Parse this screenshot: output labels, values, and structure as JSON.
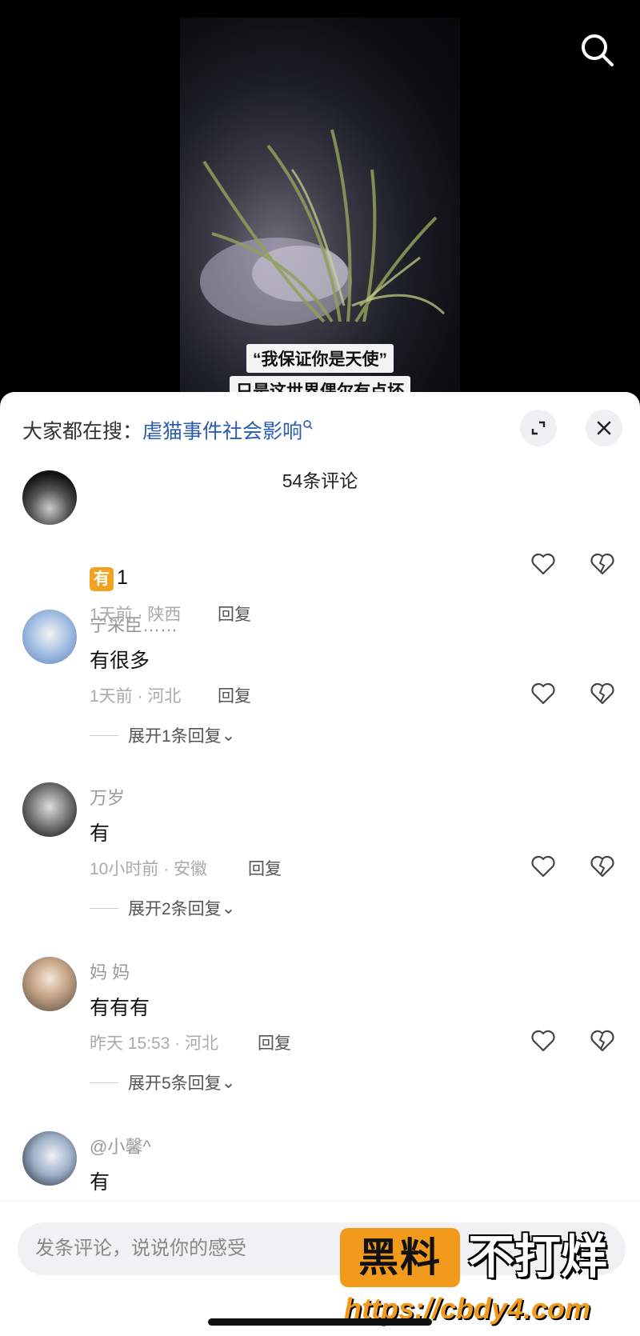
{
  "video": {
    "subtitle_line1": "“我保证你是天使”",
    "subtitle_line2": "只是这世界偶尔有点坏"
  },
  "sheet": {
    "search_prefix": "大家都在搜：",
    "search_term": "虐猫事件社会影响",
    "comment_count": "54条评论"
  },
  "comments": [
    {
      "username": "",
      "text_badge": "有",
      "text": "1",
      "time": "1天前 · 陕西",
      "reply": "回复",
      "expand": ""
    },
    {
      "username": "宁采臣……",
      "text": "有很多",
      "time": "1天前 · 河北",
      "reply": "回复",
      "expand": "展开1条回复"
    },
    {
      "username": "万岁",
      "text": "有",
      "time": "10小时前 · 安徽",
      "reply": "回复",
      "expand": "展开2条回复"
    },
    {
      "username": "妈 妈",
      "text": "有有有",
      "time": "昨天 15:53 · 河北",
      "reply": "回复",
      "expand": "展开5条回复"
    },
    {
      "username": "@小馨^",
      "text": "有",
      "time": "",
      "reply": "",
      "expand": ""
    }
  ],
  "input": {
    "placeholder": "发条评论，说说你的感受"
  },
  "watermark": {
    "badge": "黑料",
    "text": "不打烊",
    "url": "https://cbdy4.com"
  },
  "colors": {
    "link": "#2a5db0",
    "watermark_orange": "#f19a1c",
    "badge_orange": "#f0a221"
  }
}
